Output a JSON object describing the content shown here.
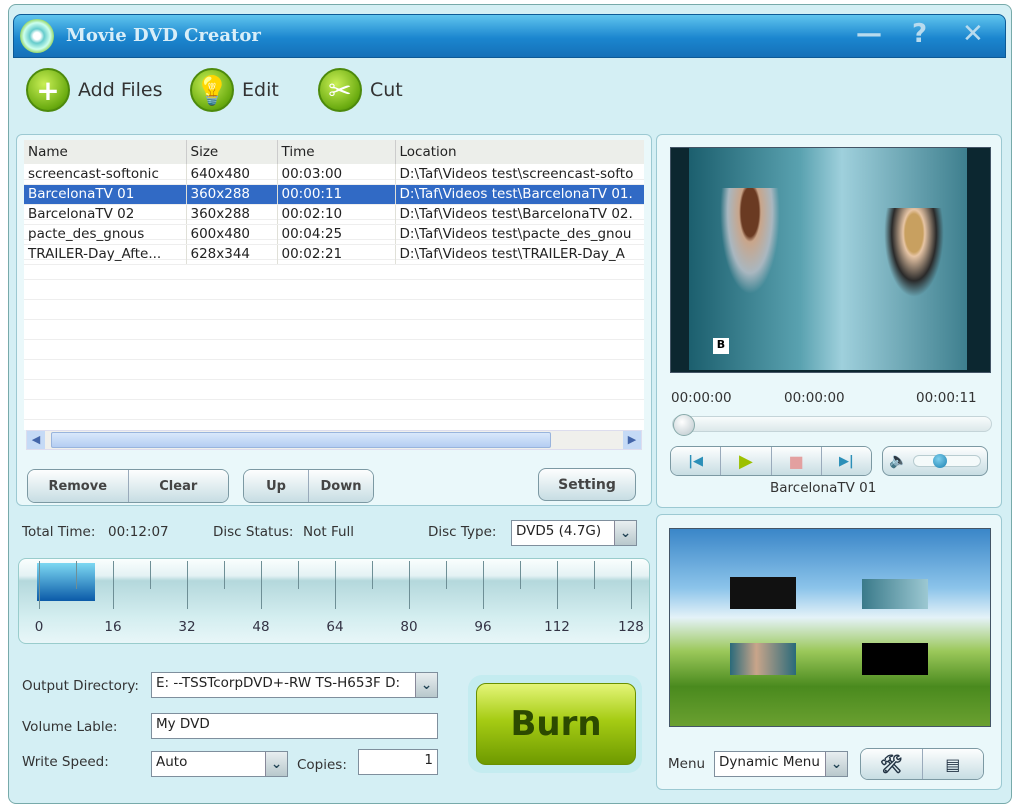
{
  "window": {
    "title": "Movie DVD Creator",
    "minimize_icon": "minimize-icon",
    "help_icon": "help-icon",
    "close_icon": "close-icon"
  },
  "toolbar": {
    "add_files": "Add Files",
    "edit": "Edit",
    "cut": "Cut"
  },
  "file_list": {
    "columns": [
      "Name",
      "Size",
      "Time",
      "Location"
    ],
    "rows": [
      [
        "screencast-softonic",
        "640x480",
        "00:03:00",
        "D:\\Taf\\Videos test\\screencast-softo"
      ],
      [
        "BarcelonaTV 01",
        "360x288",
        "00:00:11",
        "D:\\Taf\\Videos test\\BarcelonaTV 01."
      ],
      [
        "BarcelonaTV 02",
        "360x288",
        "00:02:10",
        "D:\\Taf\\Videos test\\BarcelonaTV 02."
      ],
      [
        "pacte_des_gnous",
        "600x480",
        "00:04:25",
        "D:\\Taf\\Videos test\\pacte_des_gnou"
      ],
      [
        "TRAILER-Day_Afte...",
        "628x344",
        "00:02:21",
        "D:\\Taf\\Videos test\\TRAILER-Day_A"
      ]
    ],
    "selected_index": 1
  },
  "list_buttons": {
    "remove": "Remove",
    "clear": "Clear",
    "up": "Up",
    "down": "Down",
    "setting": "Setting"
  },
  "disc": {
    "total_time_label": "Total Time:",
    "total_time": "00:12:07",
    "status_label": "Disc Status:",
    "status": "Not Full",
    "type_label": "Disc Type:",
    "type": "DVD5 (4.7G)",
    "scale_labels": [
      "0",
      "16",
      "32",
      "48",
      "64",
      "80",
      "96",
      "112",
      "128"
    ],
    "scale_max": 128,
    "used": 12.1
  },
  "output": {
    "dir_label": "Output Directory:",
    "dir": "E:  --TSSTcorpDVD+-RW TS-H653F D:",
    "volume_label": "Volume Lable:",
    "volume": "My DVD",
    "speed_label": "Write Speed:",
    "speed": "Auto",
    "copies_label": "Copies:",
    "copies": "1",
    "burn": "Burn"
  },
  "player": {
    "time_start": "00:00:00",
    "time_current": "00:00:00",
    "time_end": "00:00:11",
    "progress": 0,
    "volume": 0.35,
    "now_playing": "BarcelonaTV 01"
  },
  "menu": {
    "label": "Menu",
    "value": "Dynamic Menu"
  },
  "colors": {
    "title_bar": "#1b86cf",
    "selection": "#316ac5",
    "burn": "#8ab80a"
  }
}
